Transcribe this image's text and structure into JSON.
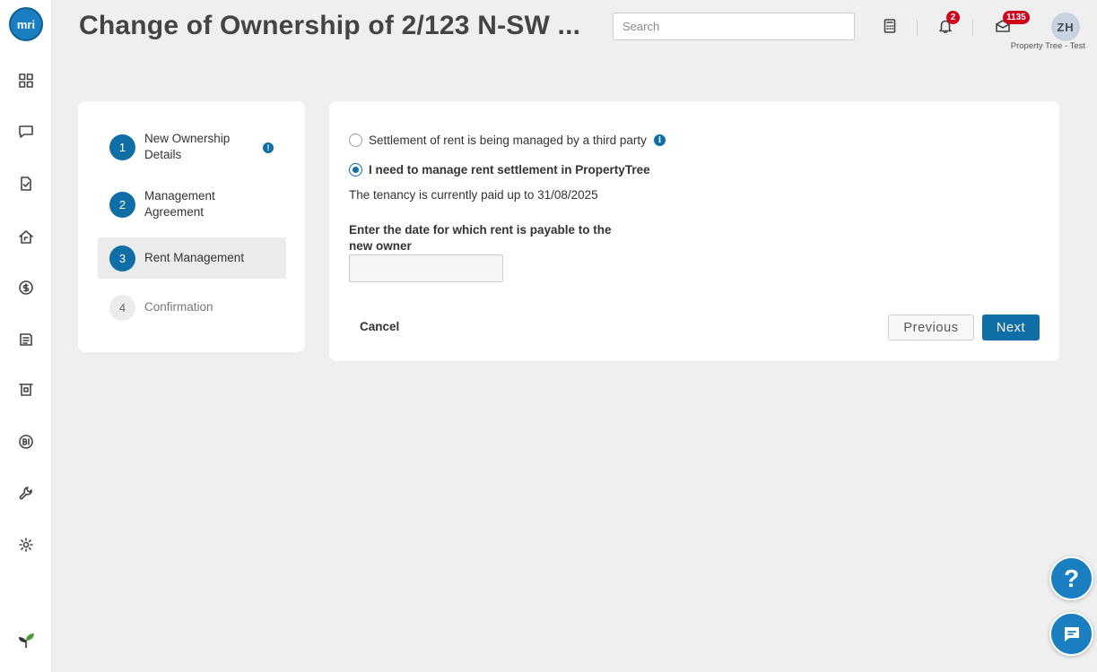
{
  "app": {
    "logo_text": "mri",
    "page_title": "Change of Ownership of 2/123 N-SW ...",
    "accent_color": "#0e6ea5"
  },
  "sidebar": {
    "items": [
      {
        "name": "dashboard-icon"
      },
      {
        "name": "messages-icon"
      },
      {
        "name": "tasks-icon"
      },
      {
        "name": "properties-icon"
      },
      {
        "name": "financials-icon"
      },
      {
        "name": "reports-icon"
      },
      {
        "name": "inspections-icon"
      },
      {
        "name": "bi-icon"
      },
      {
        "name": "tools-icon"
      },
      {
        "name": "settings-icon"
      }
    ],
    "bottom_icon": "leaf-icon"
  },
  "header": {
    "search_placeholder": "Search",
    "notifications_count": "2",
    "messages_count": "1135",
    "avatar_initials": "ZH",
    "org_name": "Property Tree - Test"
  },
  "steps": [
    {
      "number": "1",
      "label": "New Ownership Details",
      "state": "warning"
    },
    {
      "number": "2",
      "label": "Management Agreement",
      "state": "done"
    },
    {
      "number": "3",
      "label": "Rent Management",
      "state": "active"
    },
    {
      "number": "4",
      "label": "Confirmation",
      "state": "pending"
    }
  ],
  "form": {
    "option_third_party": "Settlement of rent is being managed by a third party",
    "option_property_tree": "I need to manage rent settlement in PropertyTree",
    "selected_option": "option_property_tree",
    "paid_up_text": "The tenancy is currently paid up to 31/08/2025",
    "date_label": "Enter the date for which rent is payable to the new owner",
    "date_value": ""
  },
  "actions": {
    "cancel": "Cancel",
    "previous": "Previous",
    "next": "Next"
  },
  "fabs": {
    "help": "?"
  }
}
